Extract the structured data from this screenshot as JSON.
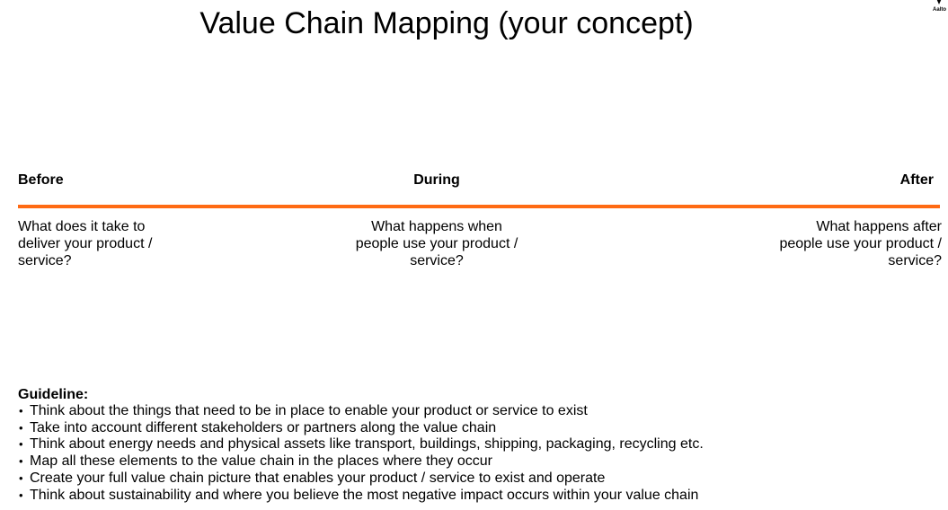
{
  "page": {
    "title": "Value Chain Mapping (your concept)",
    "logo_text": "Aalto"
  },
  "phases": [
    {
      "label": "Before",
      "question": "What does it take to\ndeliver your product /\nservice?"
    },
    {
      "label": "During",
      "question": "What happens when\npeople use your product /\nservice?"
    },
    {
      "label": "After",
      "question": "What happens after\npeople use your product /\nservice?"
    }
  ],
  "timeline": {
    "color": "#ff6a13"
  },
  "guideline": {
    "title": "Guideline:",
    "bullet": "•",
    "items": [
      "Think about the things that need to be in place to enable your product or service to exist",
      "Take into account different stakeholders or partners along the value chain",
      "Think about energy needs and physical assets like transport, buildings, shipping, packaging, recycling etc.",
      "Map all these elements to the value chain in the places where they occur",
      "Create your full value chain picture that enables your product / service to exist and operate",
      "Think about sustainability and where you believe the most negative impact occurs within your value chain"
    ]
  }
}
